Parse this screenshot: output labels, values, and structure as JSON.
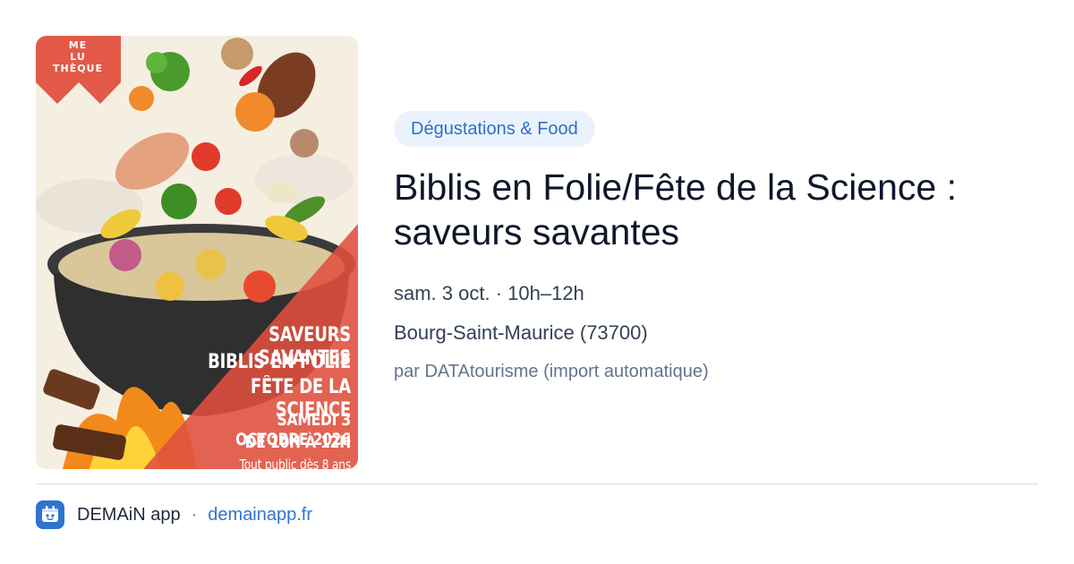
{
  "poster": {
    "logo_lines": [
      "ME",
      "LU",
      "THÈQUE"
    ],
    "lines": [
      "SAVEURS SAVANTES",
      "BIBLIS EN FOLIE",
      "FÊTE DE LA SCIENCE",
      "SAMEDI 3 OCTOBRE 2026",
      "DE 10H À 12H",
      "Tout public dès 8 ans"
    ],
    "colors": {
      "ribbon": "#e0503f",
      "pot": "#3a3a3a",
      "fire": "#f28a1b"
    }
  },
  "event": {
    "category": "Dégustations & Food",
    "title": "Biblis en Folie/Fête de la Science : saveurs savantes",
    "date": "sam. 3 oct. · 10h–12h",
    "place": "Bourg-Saint-Maurice (73700)",
    "source": "par DATAtourisme (import automatique)"
  },
  "footer": {
    "app_name": "DEMAiN app",
    "separator": "·",
    "link": "demainapp.fr",
    "icon": "demain-app-icon",
    "accent": "#2f74d0"
  }
}
